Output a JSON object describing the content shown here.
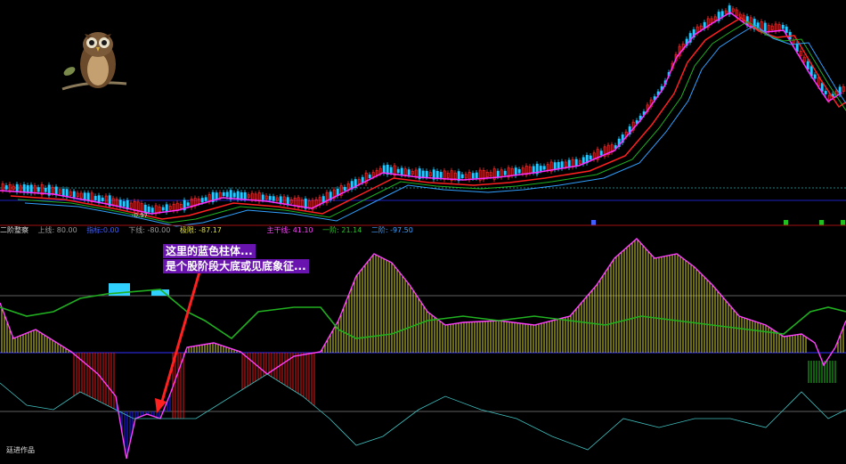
{
  "indicator_header": {
    "name": "二阶整察",
    "upper": "上线: 80.00",
    "upper2": "下线: -80.00",
    "ma": "指标:0.00",
    "depth": "极限: -87.17",
    "trend": "主干线: 41.10",
    "level1": "一阶: 21.14",
    "level2": "二阶: -97.50"
  },
  "annotation": {
    "line1": "这里的蓝色柱体...",
    "line2": "是个股阶段大底或见底象征..."
  },
  "price_low_label": "-0.97",
  "credit": "廷进作品",
  "colors": {
    "candle_up": "#ff3030",
    "candle_down": "#22c8ff",
    "ma_short": "#ff30ff",
    "ma_long": "#ff2020",
    "ma_mid": "#20b020",
    "ma_slow": "#30a0ff",
    "osc_line": "#ff40ff",
    "green_line": "#20b020",
    "bar_red": "#e01818",
    "bar_yellow": "#d8d830",
    "bar_blue": "#2020ff",
    "bar_green": "#20c020",
    "arrow": "#ff2020",
    "annotation_bg": "#6a14b0"
  }
}
